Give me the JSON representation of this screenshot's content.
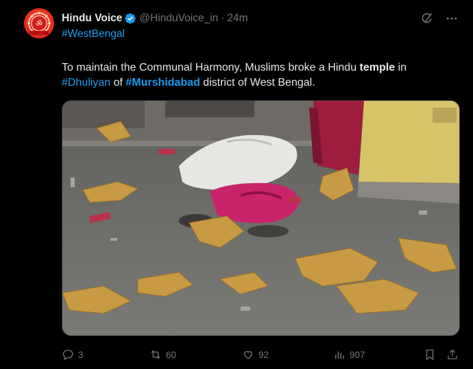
{
  "tweet": {
    "author": {
      "display_name": "Hindu Voice",
      "handle": "@HinduVoice_in",
      "verified": true,
      "avatar_icon": "om-emblem-avatar"
    },
    "separator": "·",
    "time": "24m",
    "hashtag_line": "#WestBengal",
    "text": {
      "part1": "To maintain the Communal Harmony, Muslims broke a Hindu ",
      "bold_word": "temple",
      "part2": " in ",
      "tag1": "#Dhuliyan",
      "part3": " of ",
      "tag2": "#Murshidabad",
      "part4": " district of West Bengal."
    },
    "actions": {
      "replies": "3",
      "retweets": "60",
      "likes": "92",
      "views": "907"
    },
    "colors": {
      "accent": "#1d9bf0",
      "muted": "#71767b",
      "text": "#e7e9ea",
      "background": "#000000"
    }
  }
}
